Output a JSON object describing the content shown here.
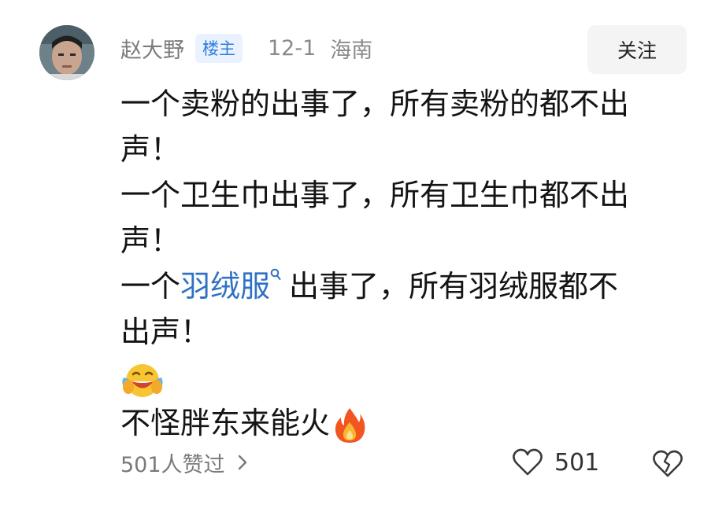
{
  "comment": {
    "username": "赵大野",
    "badge": "楼主",
    "date": "12-1",
    "location": "海南",
    "follow_label": "关注",
    "lines": [
      "一个卖粉的出事了，所有卖粉的都不出",
      "声！",
      "一个卫生巾出事了，所有卫生巾都不出",
      "声！"
    ],
    "line5_prefix": "一个",
    "topic_link": "羽绒服",
    "line5_suffix": "出事了，所有羽绒服都不",
    "line6": "出声！",
    "emoji_laugh": "face-with-tears-of-joy-emoji",
    "line8": "不怪胖东来能火",
    "emoji_fire": "fire-emoji"
  },
  "footer": {
    "likers_text": "501人赞过",
    "like_count": "501"
  },
  "icons": {
    "search": "search-icon",
    "chevron": "chevron-right-icon",
    "heart": "heart-icon",
    "broken_heart": "broken-heart-icon"
  },
  "colors": {
    "link": "#2f72c4",
    "badge_text": "#2f7fd9",
    "badge_bg": "#eaf2ff",
    "meta_text": "#8a8a8a"
  }
}
